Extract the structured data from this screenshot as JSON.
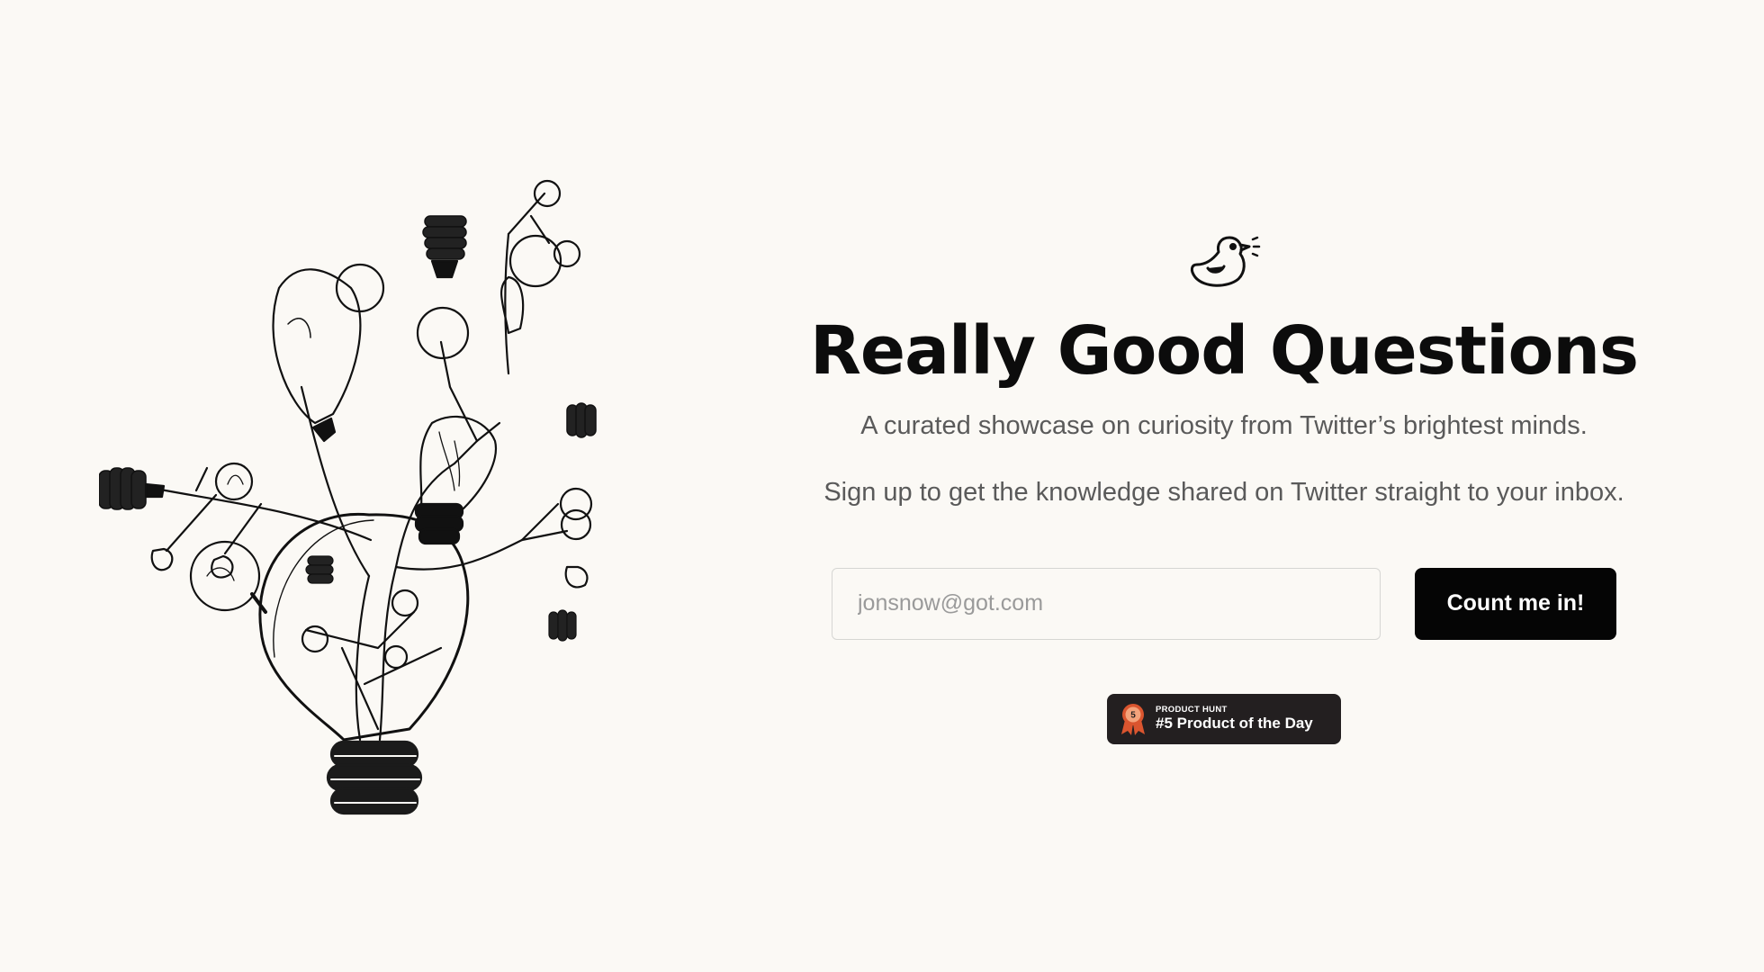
{
  "hero": {
    "title": "Really Good Questions",
    "tagline": "A curated showcase on curiosity from Twitter’s brightest minds.",
    "signup_prompt": "Sign up to get the knowledge shared on Twitter straight to your inbox."
  },
  "signup": {
    "email_placeholder": "jonsnow@got.com",
    "email_value": "",
    "button_label": "Count me in!"
  },
  "badge": {
    "kicker": "PRODUCT HUNT",
    "label": "#5 Product of the Day",
    "rank": "5",
    "medal_color": "#da552f"
  },
  "icons": {
    "logo": "bird-icon",
    "illustration": "lightbulb-tree-illustration",
    "badge": "medal-icon"
  },
  "colors": {
    "background": "#fbf9f5",
    "text": "#0c0c0c",
    "muted": "#5a5a5a",
    "button": "#050505",
    "badge_bg": "#231f20"
  }
}
